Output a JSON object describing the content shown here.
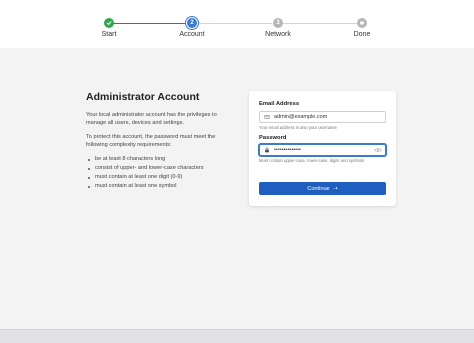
{
  "stepper": {
    "steps": [
      {
        "label": "Start",
        "state": "complete",
        "number": ""
      },
      {
        "label": "Account",
        "state": "current",
        "number": "2"
      },
      {
        "label": "Network",
        "state": "pending",
        "number": "3"
      },
      {
        "label": "Done",
        "state": "final",
        "number": ""
      }
    ]
  },
  "intro": {
    "title": "Administrator Account",
    "paragraph1": "Your local administrator account has the privileges to manage all users, devices and settings.",
    "paragraph2": "To protect this account, the password must meet the following complexity requirements:",
    "requirements": [
      "be at least 8 characters long",
      "consist of upper- and lower-case characters",
      "must contain at least one digit (0-9)",
      "must contain at least one symbol"
    ]
  },
  "form": {
    "email_label": "Email Address",
    "email_value": "admin@example.com",
    "email_help": "Your email address is also your username",
    "password_label": "Password",
    "password_value": "••••••••••••••",
    "password_help": "Must contain upper-case, lower-case, digits and symbols",
    "continue_label": "Continue"
  },
  "colors": {
    "accent": "#1f5fbf",
    "complete": "#2fa84f",
    "pending": "#b5b5ba"
  }
}
